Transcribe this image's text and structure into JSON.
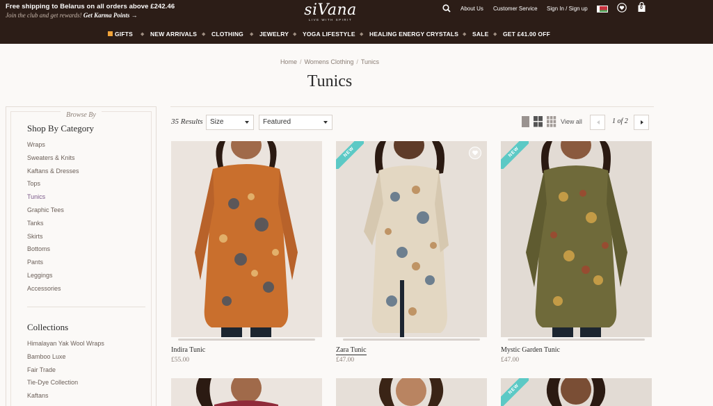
{
  "header": {
    "promo_line1": "Free shipping to Belarus on all orders above £242.46",
    "promo_line2_prefix": "Join the club and get rewards!",
    "promo_line2_link": "Get Karma Points →",
    "logo_word": "siVana",
    "logo_tagline": "LIVE WITH SPIRIT",
    "util": {
      "about": "About Us",
      "customer_service": "Customer Service",
      "sign_in": "Sign In / Sign up",
      "cart_count": "0"
    },
    "nav": [
      "GIFTS",
      "NEW ARRIVALS",
      "CLOTHING",
      "JEWELRY",
      "YOGA LIFESTYLE",
      "HEALING ENERGY CRYSTALS",
      "SALE",
      "GET £41.00 OFF"
    ]
  },
  "breadcrumb": [
    "Home",
    "Womens Clothing",
    "Tunics"
  ],
  "page_title": "Tunics",
  "sidebar": {
    "browse_by": "Browse By",
    "category_heading": "Shop By Category",
    "categories": [
      "Wraps",
      "Sweaters & Knits",
      "Kaftans & Dresses",
      "Tops",
      "Tunics",
      "Graphic Tees",
      "Tanks",
      "Skirts",
      "Bottoms",
      "Pants",
      "Leggings",
      "Accessories"
    ],
    "active_category": "Tunics",
    "collections_heading": "Collections",
    "collections": [
      "Himalayan Yak Wool Wraps",
      "Bamboo Luxe",
      "Fair Trade",
      "Tie-Dye Collection",
      "Kaftans"
    ]
  },
  "toolbar": {
    "results": "35 Results",
    "size_select": "Size",
    "sort_select": "Featured",
    "view_all": "View all",
    "pager": "1 of 2"
  },
  "products": [
    {
      "name": "Indira Tunic",
      "price": "£55.00",
      "is_new": false,
      "pattern_color": "#c96f2d"
    },
    {
      "name": "Zara Tunic",
      "price": "£47.00",
      "is_new": true,
      "pattern_color": "#e3d7c2"
    },
    {
      "name": "Mystic Garden Tunic",
      "price": "£47.00",
      "is_new": true,
      "pattern_color": "#6f6a3a"
    }
  ],
  "badge_text": "NEW"
}
